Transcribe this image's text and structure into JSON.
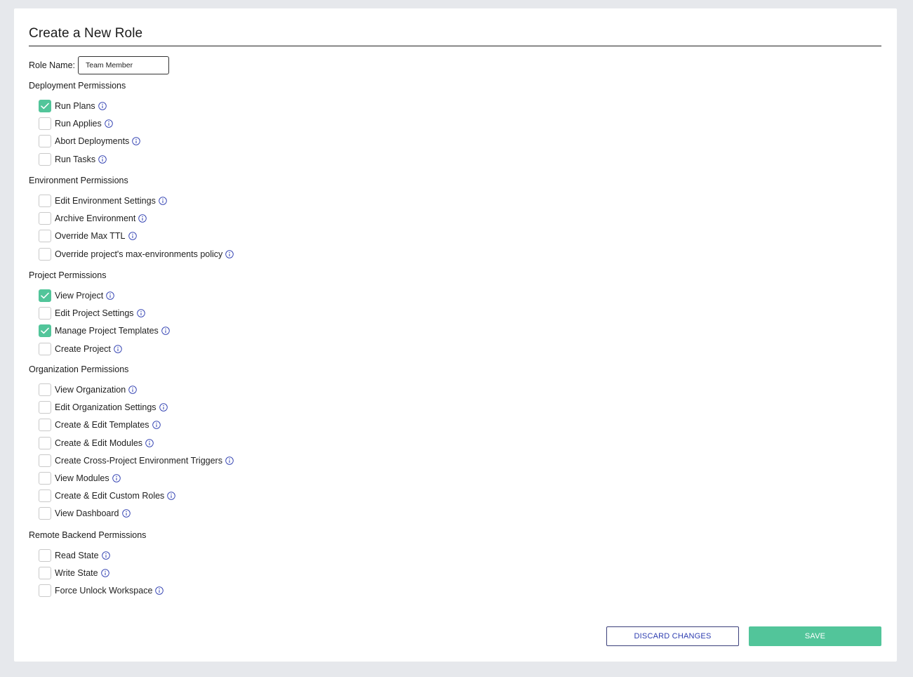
{
  "page": {
    "title": "Create a New Role"
  },
  "role": {
    "label": "Role Name:",
    "value": "Team Member"
  },
  "colors": {
    "accent": "#52c59a",
    "info": "#2d3db0"
  },
  "sections": [
    {
      "title": "Deployment Permissions",
      "items": [
        {
          "label": "Run Plans",
          "checked": true
        },
        {
          "label": "Run Applies",
          "checked": false
        },
        {
          "label": "Abort Deployments",
          "checked": false
        },
        {
          "label": "Run Tasks",
          "checked": false
        }
      ]
    },
    {
      "title": "Environment Permissions",
      "items": [
        {
          "label": "Edit Environment Settings",
          "checked": false
        },
        {
          "label": "Archive Environment",
          "checked": false
        },
        {
          "label": "Override Max TTL",
          "checked": false
        },
        {
          "label": "Override project's max-environments policy",
          "checked": false
        }
      ]
    },
    {
      "title": "Project Permissions",
      "items": [
        {
          "label": "View Project",
          "checked": true
        },
        {
          "label": "Edit Project Settings",
          "checked": false
        },
        {
          "label": "Manage Project Templates",
          "checked": true
        },
        {
          "label": "Create Project",
          "checked": false
        }
      ]
    },
    {
      "title": "Organization Permissions",
      "items": [
        {
          "label": "View Organization",
          "checked": false
        },
        {
          "label": "Edit Organization Settings",
          "checked": false
        },
        {
          "label": "Create & Edit Templates",
          "checked": false
        },
        {
          "label": "Create & Edit Modules",
          "checked": false
        },
        {
          "label": "Create Cross-Project Environment Triggers",
          "checked": false
        },
        {
          "label": "View Modules",
          "checked": false
        },
        {
          "label": "Create & Edit Custom Roles",
          "checked": false
        },
        {
          "label": "View Dashboard",
          "checked": false
        }
      ]
    },
    {
      "title": "Remote Backend Permissions",
      "items": [
        {
          "label": "Read State",
          "checked": false
        },
        {
          "label": "Write State",
          "checked": false
        },
        {
          "label": "Force Unlock Workspace",
          "checked": false
        }
      ]
    }
  ],
  "actions": {
    "discard_label": "DISCARD CHANGES",
    "save_label": "SAVE"
  }
}
